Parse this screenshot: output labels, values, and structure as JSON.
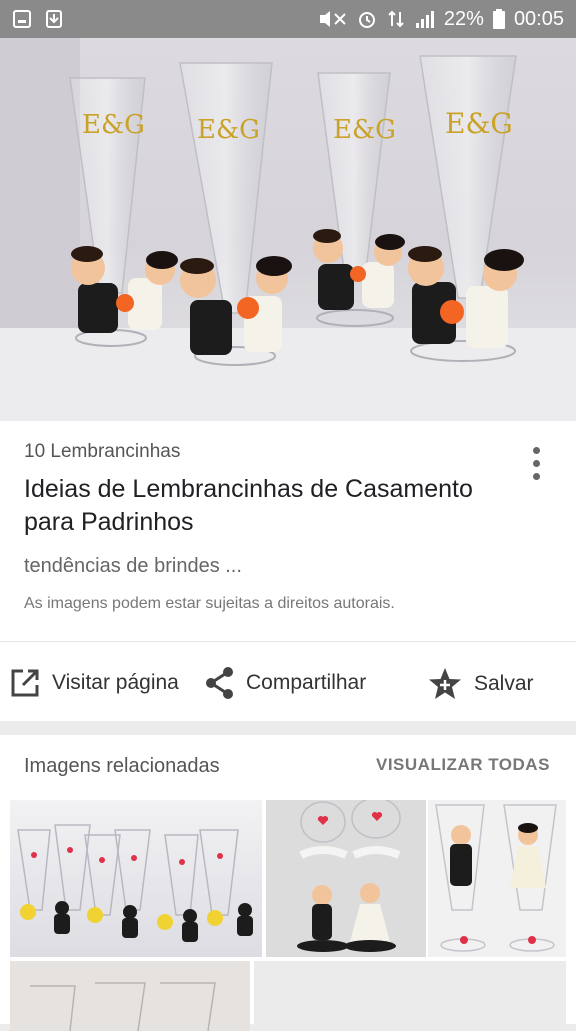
{
  "status_bar": {
    "battery": "22%",
    "time": "00:05"
  },
  "result": {
    "source": "10 Lembrancinhas",
    "title": "Ideias de Lembrancinhas de Casamento para Padrinhos",
    "subtitle": "tendências de brindes ...",
    "copyright": "As imagens podem estar sujeitas a direitos autorais."
  },
  "actions": {
    "visit_label": "Visitar página",
    "share_label": "Compartilhar",
    "save_label": "Salvar"
  },
  "related": {
    "title": "Imagens relacionadas",
    "view_all": "VISUALIZAR TODAS"
  },
  "colors": {
    "status_bar": "#8a8a8a",
    "background": "#ececec",
    "card": "#ffffff",
    "text_primary": "#202124",
    "text_secondary": "#666666",
    "glass_monogram": "#c9a227",
    "bouquet": "#f26522"
  }
}
